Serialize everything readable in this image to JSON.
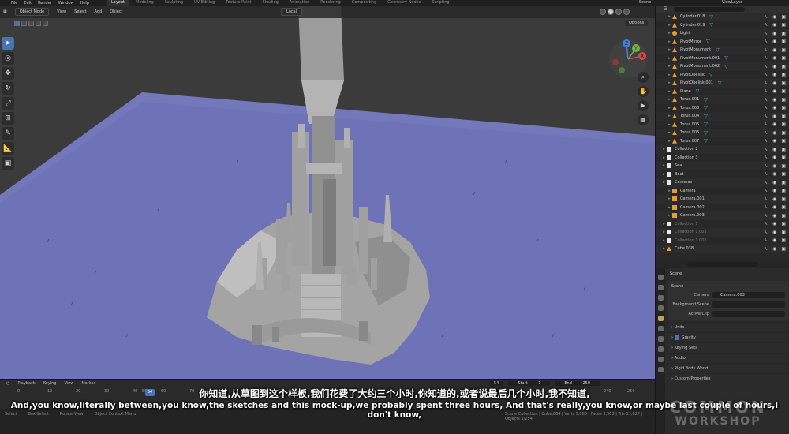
{
  "menu": [
    "File",
    "Edit",
    "Render",
    "Window",
    "Help"
  ],
  "workspace_tabs": [
    {
      "label": "Layout",
      "active": true
    },
    {
      "label": "Modeling",
      "active": false
    },
    {
      "label": "Sculpting",
      "active": false
    },
    {
      "label": "UV Editing",
      "active": false
    },
    {
      "label": "Texture Paint",
      "active": false
    },
    {
      "label": "Shading",
      "active": false
    },
    {
      "label": "Animation",
      "active": false
    },
    {
      "label": "Rendering",
      "active": false
    },
    {
      "label": "Compositing",
      "active": false
    },
    {
      "label": "Geometry Nodes",
      "active": false
    },
    {
      "label": "Scripting",
      "active": false
    }
  ],
  "top_right": {
    "scene": "Scene",
    "view_layer": "ViewLayer"
  },
  "viewport_header": {
    "mode": "Object Mode",
    "menus": [
      "View",
      "Select",
      "Add",
      "Object"
    ],
    "pivot": "Local",
    "options": "Options"
  },
  "gizmo": {
    "x": "X",
    "y": "Y",
    "z": "Z"
  },
  "outliner": {
    "rows": [
      {
        "name": "Cylinder.018",
        "icon": "mesh",
        "indent": 2,
        "mod": true,
        "dim": false
      },
      {
        "name": "Cylinder.019",
        "icon": "mesh",
        "indent": 2,
        "mod": true,
        "dim": false
      },
      {
        "name": "Light",
        "icon": "light",
        "indent": 2,
        "mod": false,
        "dim": false
      },
      {
        "name": "PivotMirror",
        "icon": "mesh",
        "indent": 2,
        "mod": true,
        "dim": false
      },
      {
        "name": "PivotMonument",
        "icon": "mesh",
        "indent": 2,
        "mod": true,
        "dim": false
      },
      {
        "name": "PivotMonument.001",
        "icon": "mesh",
        "indent": 2,
        "mod": true,
        "dim": false
      },
      {
        "name": "PivotMonument.002",
        "icon": "mesh",
        "indent": 2,
        "mod": true,
        "dim": false
      },
      {
        "name": "PivotObelisk",
        "icon": "mesh",
        "indent": 2,
        "mod": true,
        "dim": false
      },
      {
        "name": "PivotObelisk.001",
        "icon": "mesh",
        "indent": 2,
        "mod": true,
        "dim": false
      },
      {
        "name": "Plane",
        "icon": "mesh",
        "indent": 2,
        "mod": true,
        "dim": false
      },
      {
        "name": "Torus.001",
        "icon": "mesh",
        "indent": 2,
        "mod": true,
        "dim": false
      },
      {
        "name": "Torus.003",
        "icon": "mesh",
        "indent": 2,
        "mod": true,
        "dim": false
      },
      {
        "name": "Torus.004",
        "icon": "mesh",
        "indent": 2,
        "mod": true,
        "dim": false
      },
      {
        "name": "Torus.005",
        "icon": "mesh",
        "indent": 2,
        "mod": true,
        "dim": false
      },
      {
        "name": "Torus.006",
        "icon": "mesh",
        "indent": 2,
        "mod": true,
        "dim": false
      },
      {
        "name": "Torus.007",
        "icon": "mesh",
        "indent": 2,
        "mod": true,
        "dim": false
      },
      {
        "name": "Collection 2",
        "icon": "coll",
        "indent": 1,
        "mod": false,
        "dim": false
      },
      {
        "name": "Collection 3",
        "icon": "coll",
        "indent": 1,
        "mod": false,
        "dim": false
      },
      {
        "name": "Sea",
        "icon": "coll",
        "indent": 1,
        "mod": false,
        "dim": false
      },
      {
        "name": "Boat",
        "icon": "coll",
        "indent": 1,
        "mod": false,
        "dim": false
      },
      {
        "name": "Cameras",
        "icon": "coll",
        "indent": 1,
        "mod": false,
        "dim": false
      },
      {
        "name": "Camera",
        "icon": "cam",
        "indent": 2,
        "mod": false,
        "dim": false
      },
      {
        "name": "Camera.001",
        "icon": "cam",
        "indent": 2,
        "mod": false,
        "dim": false
      },
      {
        "name": "Camera.002",
        "icon": "cam",
        "indent": 2,
        "mod": false,
        "dim": false
      },
      {
        "name": "Camera.003",
        "icon": "cam",
        "indent": 2,
        "mod": false,
        "dim": false
      },
      {
        "name": "Collection 1",
        "icon": "coll",
        "indent": 1,
        "mod": false,
        "dim": true
      },
      {
        "name": "Collection 1.001",
        "icon": "coll",
        "indent": 1,
        "mod": false,
        "dim": true
      },
      {
        "name": "Collection 1.002",
        "icon": "coll",
        "indent": 1,
        "mod": false,
        "dim": true
      },
      {
        "name": "Cube.038",
        "icon": "mesh",
        "indent": 1,
        "mod": false,
        "dim": false
      }
    ]
  },
  "properties": {
    "title": "Scene",
    "section_scene": "Scene",
    "fields": [
      {
        "label": "Camera",
        "value": "Camera.003"
      },
      {
        "label": "Background Scene",
        "value": ""
      },
      {
        "label": "Active Clip",
        "value": ""
      }
    ],
    "sections": [
      "Units",
      "Gravity",
      "Keying Sets",
      "Audio",
      "Rigid Body World",
      "Custom Properties"
    ]
  },
  "timeline": {
    "menus": [
      "Playback",
      "Keying",
      "View",
      "Marker"
    ],
    "current_frame": "54",
    "start_label": "Start",
    "start": "1",
    "end_label": "End",
    "end": "250",
    "ticks": [
      "0",
      "10",
      "20",
      "30",
      "40",
      "50",
      "54",
      "60",
      "70",
      "240",
      "250"
    ]
  },
  "statusbar": {
    "items": [
      "Select",
      "Box Select",
      "Rotate View",
      "Object Context Menu"
    ],
    "stats": "Scene Collection | Cube.064 | Verts 5,880 | Faces 5,903 | Tris 11,627 | Objects 1/254"
  },
  "subtitles": {
    "zh": "你知道,从草图到这个样板,我们花费了大约三个小时,你知道的,或者说最后几个小时,我不知道,",
    "en": "And,you know,literally between,you know,the sketches and this mock-up,we probably spent three hours, And that's really,you know,or maybe last couple of hours,I don't know,"
  },
  "watermark": {
    "line1": "COMMON",
    "line2": "WORKSHOP"
  },
  "colors": {
    "ocean": "#6d73b6",
    "model": "#a9a9a9",
    "accent": "#4772b3",
    "background": "#3b3b3b"
  }
}
